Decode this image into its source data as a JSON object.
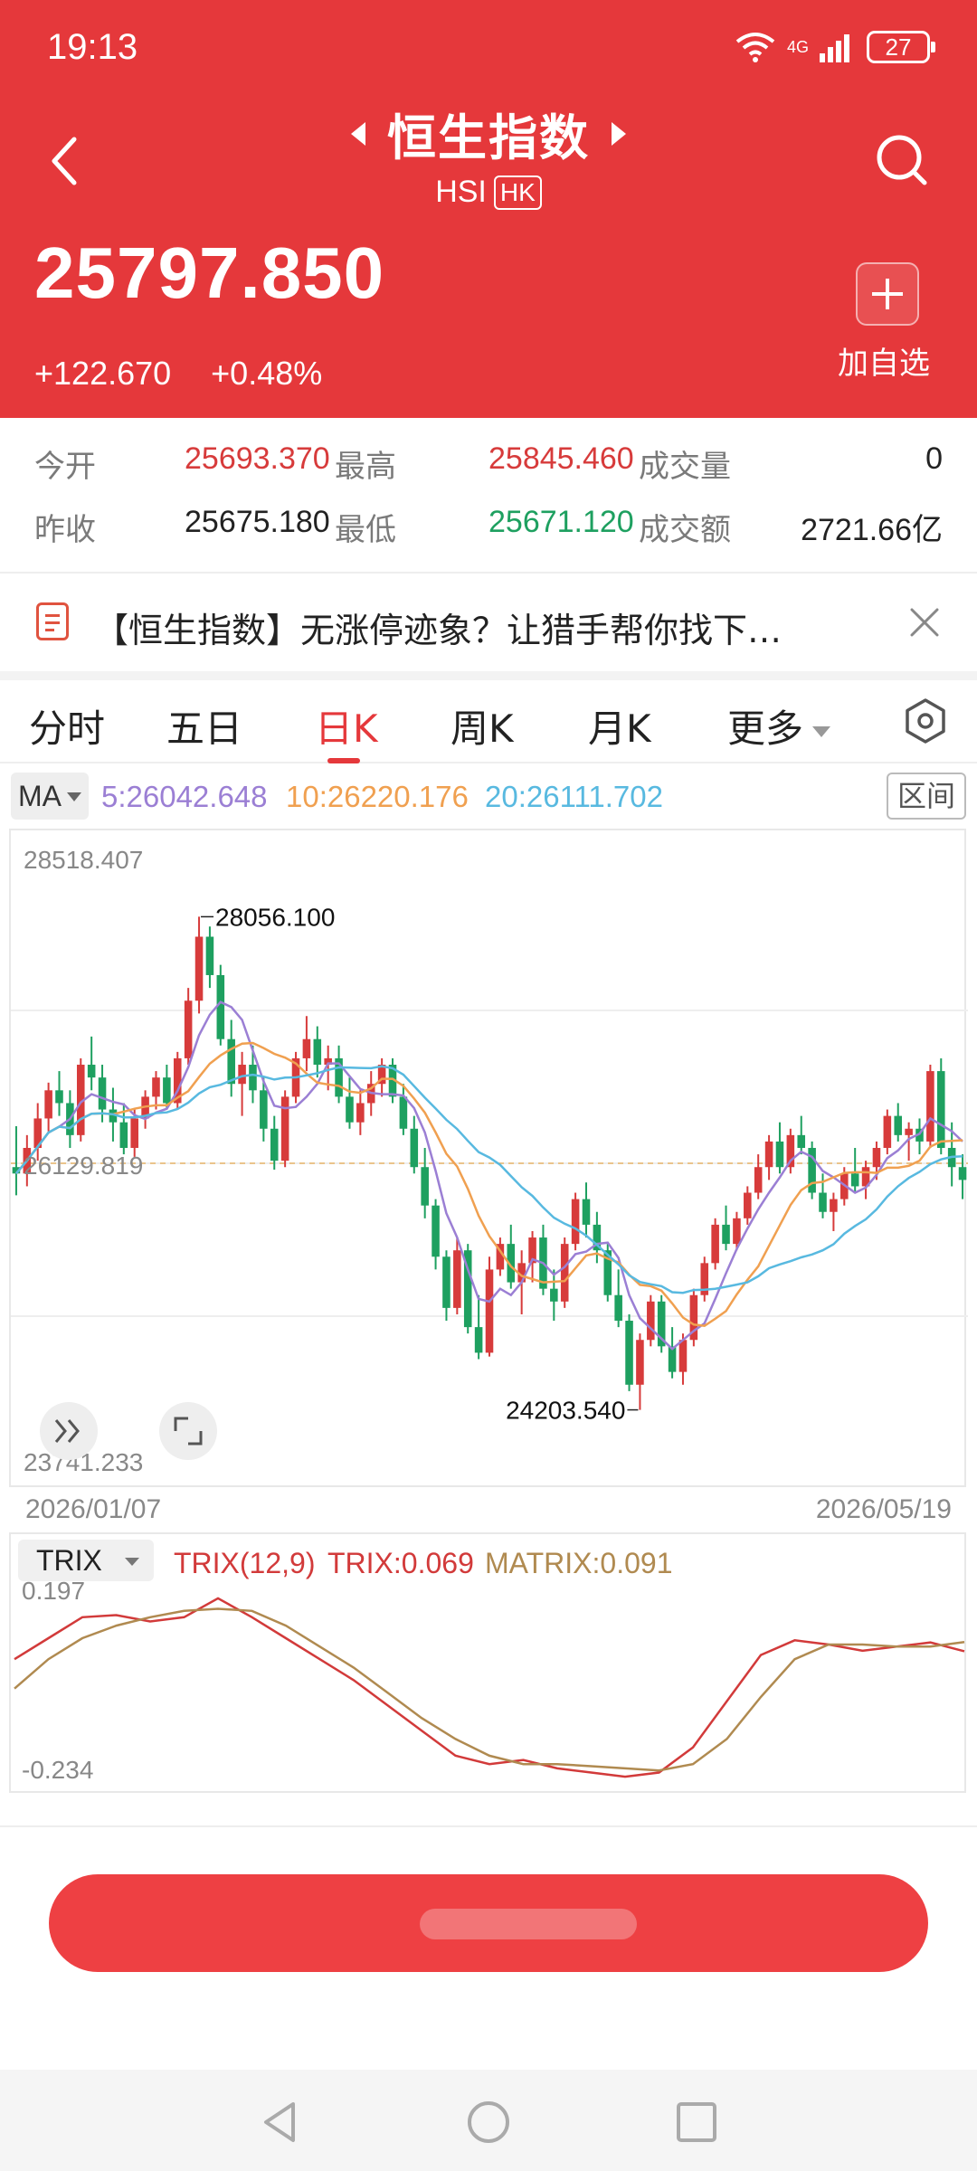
{
  "status": {
    "time": "19:13",
    "network": "4G",
    "battery": "27"
  },
  "header": {
    "title": "恒生指数",
    "code": "HSI",
    "market_badge": "HK",
    "price": "25797.850",
    "change": "+122.670",
    "change_pct": "+0.48%",
    "add_label": "加自选"
  },
  "stats": {
    "open_label": "今开",
    "open": "25693.370",
    "high_label": "最高",
    "high": "25845.460",
    "volume_label": "成交量",
    "volume": "0",
    "prev_label": "昨收",
    "prev": "25675.180",
    "low_label": "最低",
    "low": "25671.120",
    "turnover_label": "成交额",
    "turnover": "2721.66亿"
  },
  "news": {
    "text": "【恒生指数】无涨停迹象？让猎手帮你找下…"
  },
  "tabs": [
    "分时",
    "五日",
    "日K",
    "周K",
    "月K",
    "更多"
  ],
  "ma": {
    "selector": "MA",
    "ma5": "5:26042.648",
    "ma10": "10:26220.176",
    "ma20": "20:26111.702",
    "range_label": "区间"
  },
  "chart": {
    "y_high": "28518.407",
    "y_mid": "26129.819",
    "y_low": "23741.233",
    "max_label": "28056.100",
    "min_label": "24203.540",
    "date_start": "2026/01/07",
    "date_end": "2026/05/19"
  },
  "trix": {
    "selector": "TRIX",
    "params": "TRIX(12,9)",
    "trix_val": "TRIX:0.069",
    "matrix_val": "MATRIX:0.091",
    "y_top": "0.197",
    "y_bottom": "-0.234"
  },
  "colors": {
    "up": "#d73b3b",
    "down": "#1ea060",
    "ma5": "#9b7fd4",
    "ma10": "#f0a050",
    "ma20": "#58b9e0",
    "trix": "#d23a3a",
    "matrix": "#b08a50",
    "header": "#e5383b"
  },
  "chart_data": [
    {
      "type": "candlestick",
      "x_range": [
        "2026/01/07",
        "2026/05/19"
      ],
      "ylim": [
        23741.233,
        28518.407
      ],
      "y_ticks": [
        23741.233,
        26129.819,
        28518.407
      ],
      "annotated_high": 28056.1,
      "annotated_low": 24203.54,
      "moving_averages": [
        {
          "name": "MA5",
          "value": 26042.648
        },
        {
          "name": "MA10",
          "value": 26220.176
        },
        {
          "name": "MA20",
          "value": 26111.702
        }
      ],
      "candles": [
        [
          26100,
          26420,
          25880,
          26050
        ],
        [
          26050,
          26350,
          25950,
          26250
        ],
        [
          26250,
          26600,
          26150,
          26480
        ],
        [
          26480,
          26760,
          26380,
          26700
        ],
        [
          26700,
          26850,
          26500,
          26600
        ],
        [
          26600,
          26700,
          26250,
          26350
        ],
        [
          26350,
          26950,
          26300,
          26900
        ],
        [
          26900,
          27120,
          26700,
          26800
        ],
        [
          26800,
          26900,
          26450,
          26550
        ],
        [
          26550,
          26720,
          26300,
          26450
        ],
        [
          26450,
          26600,
          26200,
          26250
        ],
        [
          26250,
          26550,
          26180,
          26480
        ],
        [
          26480,
          26700,
          26400,
          26650
        ],
        [
          26650,
          26850,
          26550,
          26800
        ],
        [
          26800,
          26900,
          26550,
          26600
        ],
        [
          26600,
          27000,
          26550,
          26950
        ],
        [
          26950,
          27500,
          26900,
          27400
        ],
        [
          27400,
          28056,
          27300,
          27900
        ],
        [
          27900,
          27980,
          27500,
          27600
        ],
        [
          27600,
          27680,
          27050,
          27100
        ],
        [
          27100,
          27250,
          26650,
          26750
        ],
        [
          26750,
          27000,
          26500,
          26900
        ],
        [
          26900,
          27050,
          26600,
          26700
        ],
        [
          26700,
          26800,
          26300,
          26400
        ],
        [
          26400,
          26500,
          26080,
          26150
        ],
        [
          26150,
          26700,
          26100,
          26650
        ],
        [
          26650,
          27000,
          26600,
          26950
        ],
        [
          26950,
          27280,
          26850,
          27100
        ],
        [
          27100,
          27200,
          26800,
          26900
        ],
        [
          26900,
          27050,
          26700,
          26950
        ],
        [
          26950,
          27050,
          26600,
          26650
        ],
        [
          26650,
          26800,
          26400,
          26450
        ],
        [
          26450,
          26700,
          26350,
          26600
        ],
        [
          26600,
          26850,
          26500,
          26750
        ],
        [
          26750,
          26950,
          26650,
          26900
        ],
        [
          26900,
          26950,
          26600,
          26650
        ],
        [
          26650,
          26750,
          26350,
          26400
        ],
        [
          26400,
          26500,
          26050,
          26100
        ],
        [
          26100,
          26250,
          25700,
          25800
        ],
        [
          25800,
          25850,
          25300,
          25400
        ],
        [
          25400,
          25450,
          24900,
          25000
        ],
        [
          25000,
          25550,
          24950,
          25450
        ],
        [
          25450,
          25500,
          24800,
          24850
        ],
        [
          24850,
          25100,
          24600,
          24650
        ],
        [
          24650,
          25400,
          24620,
          25300
        ],
        [
          25300,
          25550,
          25250,
          25500
        ],
        [
          25500,
          25650,
          25150,
          25200
        ],
        [
          25200,
          25450,
          24950,
          25350
        ],
        [
          25350,
          25600,
          25200,
          25550
        ],
        [
          25550,
          25650,
          25100,
          25150
        ],
        [
          25150,
          25300,
          24900,
          25050
        ],
        [
          25050,
          25550,
          25000,
          25500
        ],
        [
          25500,
          25900,
          25450,
          25850
        ],
        [
          25850,
          25980,
          25550,
          25650
        ],
        [
          25650,
          25750,
          25350,
          25450
        ],
        [
          25450,
          25500,
          25050,
          25100
        ],
        [
          25100,
          25300,
          24850,
          24900
        ],
        [
          24900,
          24950,
          24350,
          24400
        ],
        [
          24400,
          24800,
          24203.54,
          24750
        ],
        [
          24750,
          25100,
          24700,
          25050
        ],
        [
          25050,
          25100,
          24650,
          24700
        ],
        [
          24700,
          24850,
          24450,
          24500
        ],
        [
          24500,
          24800,
          24400,
          24750
        ],
        [
          24750,
          25150,
          24700,
          25100
        ],
        [
          25100,
          25400,
          25050,
          25350
        ],
        [
          25350,
          25700,
          25300,
          25650
        ],
        [
          25650,
          25800,
          25450,
          25500
        ],
        [
          25500,
          25750,
          25450,
          25700
        ],
        [
          25700,
          25950,
          25650,
          25900
        ],
        [
          25900,
          26200,
          25850,
          26100
        ],
        [
          26100,
          26350,
          26000,
          26300
        ],
        [
          26300,
          26450,
          26050,
          26100
        ],
        [
          26100,
          26400,
          26050,
          26350
        ],
        [
          26350,
          26500,
          26200,
          26250
        ],
        [
          26250,
          26300,
          25850,
          25900
        ],
        [
          25900,
          26050,
          25700,
          25750
        ],
        [
          25750,
          25900,
          25600,
          25850
        ],
        [
          25850,
          26100,
          25800,
          26050
        ],
        [
          26050,
          26250,
          25900,
          25950
        ],
        [
          25950,
          26150,
          25850,
          26100
        ],
        [
          26100,
          26300,
          26000,
          26250
        ],
        [
          26250,
          26550,
          26200,
          26500
        ],
        [
          26500,
          26600,
          26300,
          26350
        ],
        [
          26350,
          26450,
          26150,
          26400
        ],
        [
          26400,
          26480,
          26200,
          26300
        ],
        [
          26300,
          26900,
          26250,
          26850
        ],
        [
          26850,
          26950,
          26200,
          26250
        ],
        [
          26250,
          26450,
          25950,
          26100
        ],
        [
          26100,
          26200,
          25850,
          26000
        ]
      ]
    },
    {
      "type": "line",
      "title": "TRIX(12,9)",
      "ylim": [
        -0.234,
        0.197
      ],
      "series": [
        {
          "name": "TRIX",
          "values": [
            0.05,
            0.1,
            0.15,
            0.155,
            0.14,
            0.15,
            0.195,
            0.15,
            0.1,
            0.05,
            0.0,
            -0.06,
            -0.12,
            -0.18,
            -0.2,
            -0.19,
            -0.21,
            -0.22,
            -0.23,
            -0.22,
            -0.16,
            -0.05,
            0.06,
            0.095,
            0.085,
            0.07,
            0.08,
            0.09,
            0.069
          ]
        },
        {
          "name": "MATRIX",
          "values": [
            -0.02,
            0.05,
            0.1,
            0.13,
            0.15,
            0.165,
            0.17,
            0.165,
            0.13,
            0.08,
            0.03,
            -0.03,
            -0.09,
            -0.14,
            -0.18,
            -0.2,
            -0.2,
            -0.205,
            -0.21,
            -0.215,
            -0.2,
            -0.14,
            -0.04,
            0.05,
            0.085,
            0.085,
            0.08,
            0.08,
            0.091
          ]
        }
      ]
    }
  ]
}
